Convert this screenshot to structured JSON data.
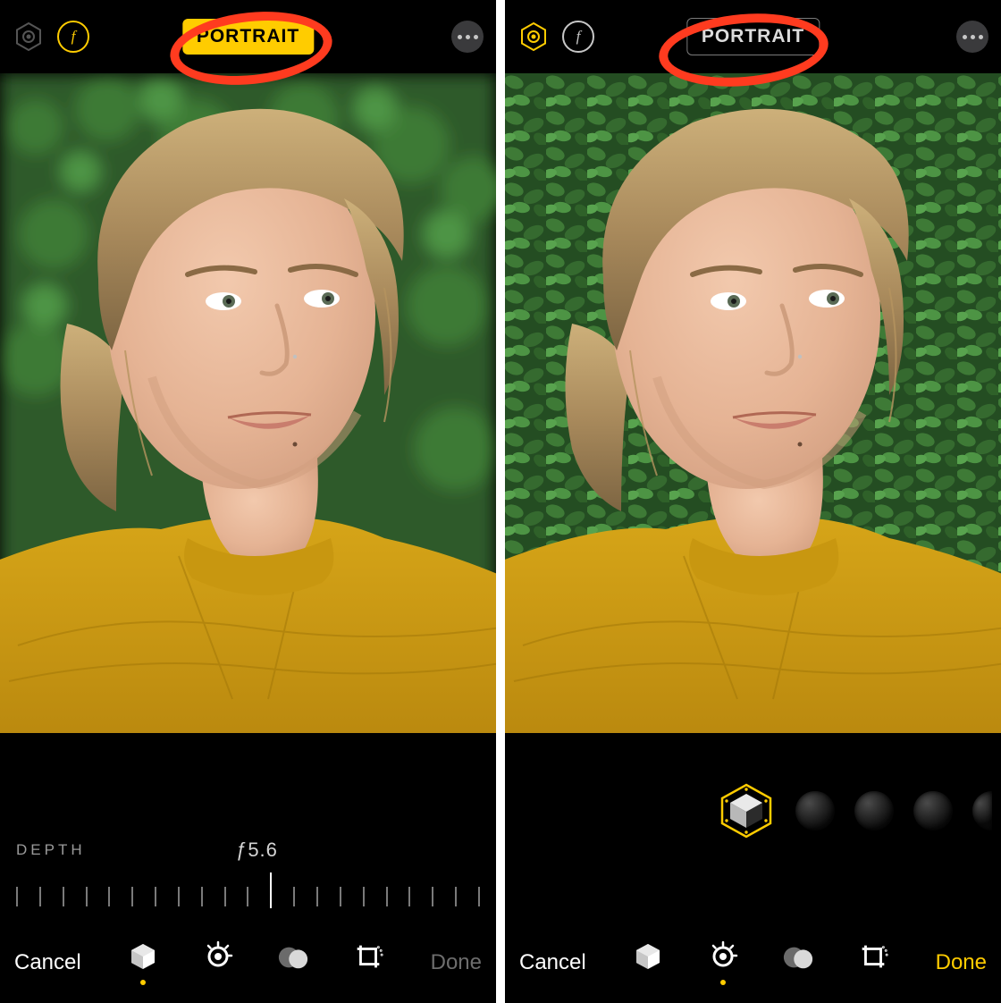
{
  "left": {
    "mode_label": "PORTRAIT",
    "mode_active": true,
    "depth_label": "DEPTH",
    "depth_value": "ƒ5.6",
    "ruler_ticks": 21,
    "ruler_marker_index": 11,
    "cancel_label": "Cancel",
    "done_label": "Done",
    "done_enabled": false,
    "active_tab_index": 0,
    "tabs": [
      "portrait",
      "adjust",
      "filters",
      "crop"
    ],
    "annotation": {
      "shape": "ellipse",
      "color": "#ff3b1f",
      "target": "mode-badge"
    },
    "photo": {
      "subject": "woman",
      "pose": "head-and-shoulders, 3/4 right",
      "hair": "blonde, low ponytail",
      "top": "mustard yellow knit sweater",
      "background": "green hedge foliage",
      "background_blur": true
    }
  },
  "right": {
    "mode_label": "PORTRAIT",
    "mode_active": false,
    "cancel_label": "Cancel",
    "done_label": "Done",
    "done_enabled": true,
    "active_tab_index": 1,
    "tabs": [
      "portrait",
      "adjust",
      "filters",
      "crop"
    ],
    "lighting_selected_index": 0,
    "lighting_options": [
      "natural",
      "studio",
      "contour",
      "stage"
    ],
    "lighting_options_partial": "stage-mono",
    "annotation": {
      "shape": "ellipse",
      "color": "#ff3b1f",
      "target": "mode-badge"
    },
    "photo": {
      "subject": "woman",
      "pose": "head-and-shoulders, 3/4 right",
      "hair": "blonde, low ponytail",
      "top": "mustard yellow knit sweater",
      "background": "green hedge foliage",
      "background_blur": false
    }
  },
  "icons": {
    "live_photo": "live-photo-icon",
    "aperture": "aperture-f-icon",
    "more": "more-horizontal-icon",
    "cube": "cube-icon",
    "adjust": "adjust-dial-icon",
    "filters": "filters-overlap-icon",
    "crop": "crop-rotate-icon",
    "hex_light": "hex-light-icon"
  },
  "colors": {
    "accent": "#ffcc00",
    "annotation": "#ff3b1f",
    "background": "#000000"
  }
}
